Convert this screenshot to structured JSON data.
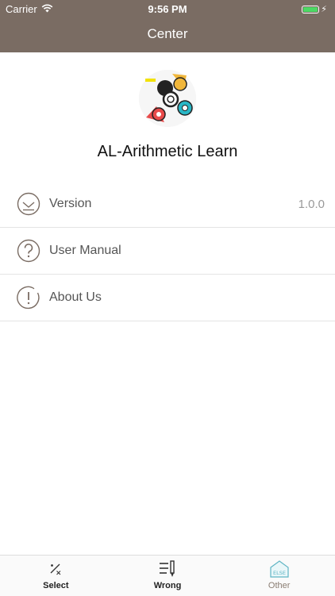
{
  "status_bar": {
    "carrier": "Carrier",
    "time": "9:56 PM"
  },
  "nav": {
    "title": "Center"
  },
  "app": {
    "name": "AL-Arithmetic Learn"
  },
  "menu": [
    {
      "label": "Version",
      "value": "1.0.0",
      "icon": "download-circle-icon"
    },
    {
      "label": "User Manual",
      "value": "",
      "icon": "question-circle-icon"
    },
    {
      "label": "About Us",
      "value": "",
      "icon": "info-circle-icon"
    }
  ],
  "tabs": [
    {
      "label": "Select",
      "icon": "percent-x-icon",
      "active": false
    },
    {
      "label": "Wrong",
      "icon": "list-pencil-icon",
      "active": false
    },
    {
      "label": "Other",
      "icon": "else-house-icon",
      "active": true
    }
  ],
  "colors": {
    "nav_bar": "#7a6c63",
    "battery": "#4cd964",
    "active_tab": "#8a7d72"
  }
}
